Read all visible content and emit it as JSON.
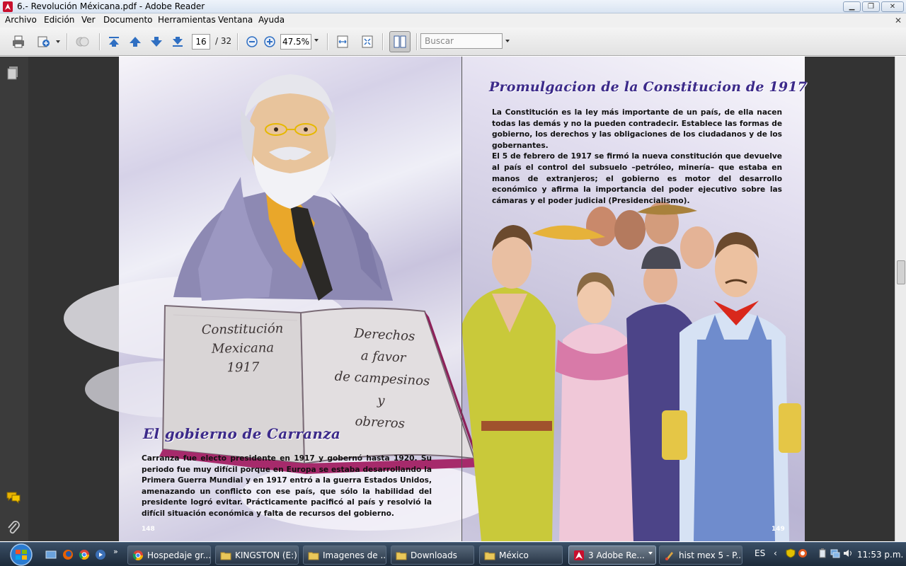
{
  "window": {
    "title": "6.- Revolución Méxicana.pdf - Adobe Reader"
  },
  "menu": {
    "items": [
      "Archivo",
      "Edición",
      "Ver",
      "Documento",
      "Herramientas",
      "Ventana",
      "Ayuda"
    ]
  },
  "toolbar": {
    "current_page": "16",
    "total_pages": "/ 32",
    "zoom": "47.5%",
    "search_placeholder": "Buscar"
  },
  "document": {
    "left_page": {
      "heading": "El gobierno de Carranza",
      "paragraph": "Carranza fue electo presidente en 1917 y gobernó hasta 1920. Su periodo fue muy difícil porque en Europa se estaba desarrollando la Primera Guerra Mundial y en 1917 entró a la guerra Estados Unidos, amenazando un conflicto con ese país, que sólo la habilidad del presidente logró evitar. Prácticamente pacificó al país y resolvió la difícil situación económica y falta de recursos del gobierno.",
      "page_number": "148",
      "book_left_page": [
        "Constitución",
        "Mexicana",
        "1917"
      ],
      "book_right_page": [
        "Derechos",
        "a favor",
        "de campesinos",
        "y",
        "obreros"
      ]
    },
    "right_page": {
      "heading": "Promulgacion de la Constitucion de 1917",
      "paragraph_1": "La Constitución es la ley más importante de un país, de ella nacen todas las demás y no la pueden contradecir. Establece las formas de gobierno, los derechos y las obligaciones de los ciudadanos y de los gobernantes.",
      "paragraph_2": "El 5 de febrero de 1917 se firmó la nueva constitución que devuelve al país el control del subsuelo –petróleo, minería– que estaba en manos de extranjeros; el gobierno es motor del desarrollo económico y afirma la importancia del poder ejecutivo sobre las cámaras y el poder judicial (Presidencialismo).",
      "page_number": "149"
    }
  },
  "taskbar": {
    "tasks": [
      {
        "label": "Hospedaje gr...",
        "icon": "chrome-icon"
      },
      {
        "label": "KINGSTON (E:)",
        "icon": "folder-icon"
      },
      {
        "label": "Imagenes de ...",
        "icon": "folder-icon"
      },
      {
        "label": "Downloads",
        "icon": "folder-icon"
      },
      {
        "label": "México",
        "icon": "folder-icon"
      },
      {
        "label": "3 Adobe Re...",
        "icon": "adobe-icon"
      },
      {
        "label": "hist mex 5 - P...",
        "icon": "paint-icon"
      }
    ],
    "language": "ES",
    "clock": "11:53 p.m."
  }
}
